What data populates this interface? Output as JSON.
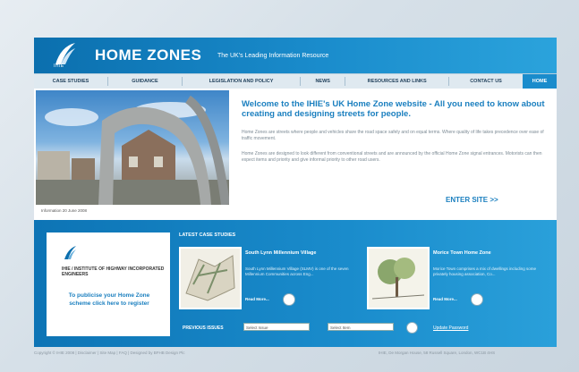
{
  "header": {
    "title": "HOME ZONES",
    "tagline": "The UK's Leading Information Resource",
    "logo_text": "IHIE"
  },
  "nav": {
    "items": [
      "CASE STUDIES",
      "GUIDANCE",
      "LEGISLATION AND POLICY",
      "NEWS",
      "RESOURCES AND LINKS",
      "CONTACT US"
    ],
    "home": "HOME"
  },
  "hero": {
    "caption": "Information 20 June 2008",
    "welcome": "Welcome to the IHIE's UK Home Zone website - All you need to know about creating and designing streets for people.",
    "para1": "Home Zones are streets where people and vehicles share the road space safely and on equal terms. Where quality of life takes precedence over ease of traffic movement.",
    "para2": "Home Zones are designed to look different from conventional streets and are announced by the official Home Zone signal entrances. Motorists can then expect items and priority and give informal priority to other road users.",
    "enter": "ENTER SITE >>"
  },
  "promo": {
    "org": "IHIE / INSTITUTE OF HIGHWAY INCORPORATED ENGINEERS",
    "text": "To publicise your Home Zone scheme click here to register"
  },
  "case_studies": {
    "title": "LATEST CASE STUDIES",
    "items": [
      {
        "title": "South Lynn Millennium Village",
        "desc": "South Lynn Millennium Village (SLMV) is one of the seven Millennium Communities across Eng...",
        "readmore": "Read More..."
      },
      {
        "title": "Morice Town Home Zone",
        "desc": "Morice Town comprises a mix of dwellings including some privately housing association, Co...",
        "readmore": "Read More..."
      }
    ]
  },
  "search": {
    "label": "PREVIOUS ISSUES",
    "select1": "Select Issue",
    "select2": "Select Item",
    "update": "Update Password"
  },
  "footer": {
    "left": "Copyright © IHIE 2008 | Disclaimer | Site Map | FAQ | Designed by BFHB Design Plc",
    "right": "IHIE, De Morgan House, 58 Russell Square, London, WC1B 4HS"
  },
  "colors": {
    "brand": "#1a8ccc",
    "dark": "#0b6fae"
  }
}
